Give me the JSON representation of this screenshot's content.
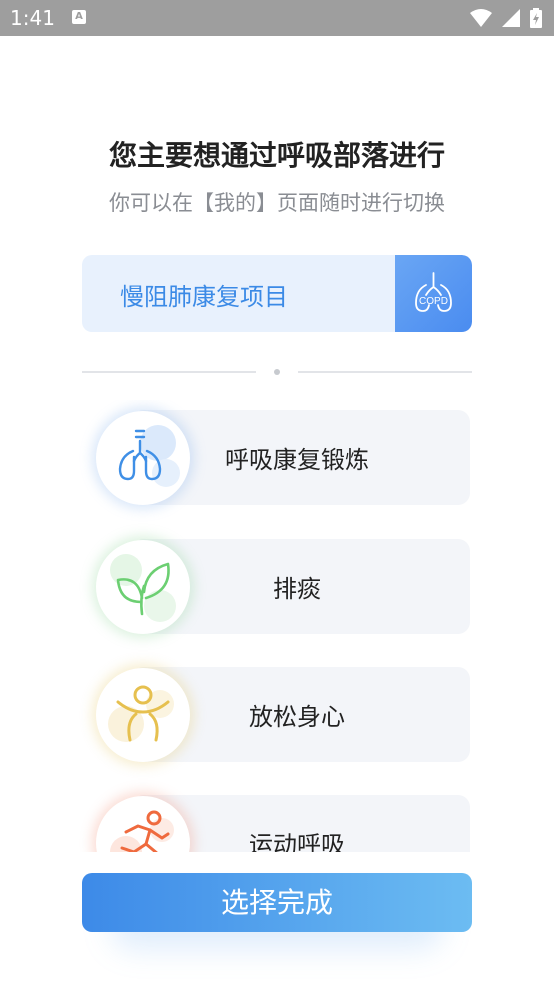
{
  "status_bar": {
    "time": "1:41",
    "notification_letter": "A"
  },
  "header": {
    "title": "您主要想通过呼吸部落进行",
    "subtitle": "你可以在【我的】页面随时进行切换"
  },
  "project": {
    "label": "慢阻肺康复项目",
    "badge_text": "COPD"
  },
  "options": [
    {
      "label": "呼吸康复锻炼",
      "icon": "lungs-icon",
      "color": "#3f8fe6"
    },
    {
      "label": "排痰",
      "icon": "leaf-icon",
      "color": "#6ccf72"
    },
    {
      "label": "放松身心",
      "icon": "relax-person-icon",
      "color": "#e6c04f"
    },
    {
      "label": "运动呼吸",
      "icon": "running-person-icon",
      "color": "#ef6a3e"
    }
  ],
  "confirm_button": {
    "label": "选择完成"
  },
  "colors": {
    "accent": "#3b8ae6",
    "status_bar": "#9e9e9e"
  }
}
